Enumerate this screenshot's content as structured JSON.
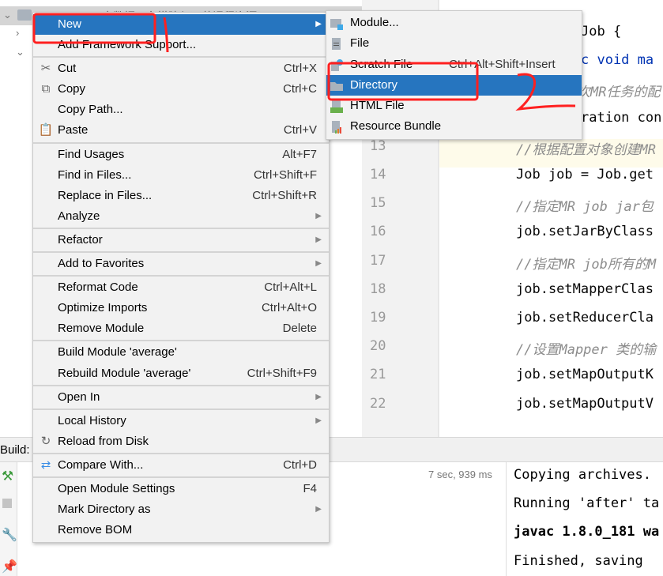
{
  "tree": {
    "root_label": "E:\\大数据平台搭建与运营课程资源"
  },
  "editor": {
    "lines": [
      {
        "num": "",
        "text": "Job {",
        "kind": "code"
      },
      {
        "num": "",
        "text": "c void ma",
        "kind": "kw"
      },
      {
        "num": "",
        "text": "次MR任务的配",
        "kind": "cmt"
      },
      {
        "num": "",
        "text": "ration con",
        "kind": "code"
      },
      {
        "num": "13",
        "text": "//根据配置对象创建MR",
        "kind": "cmt"
      },
      {
        "num": "14",
        "text": "Job job = Job.get",
        "kind": "code"
      },
      {
        "num": "15",
        "text": "//指定MR job jar包",
        "kind": "cmt"
      },
      {
        "num": "16",
        "text": "job.setJarByClass",
        "kind": "code"
      },
      {
        "num": "17",
        "text": "//指定MR job所有的M",
        "kind": "cmt"
      },
      {
        "num": "18",
        "text": "job.setMapperClas",
        "kind": "code"
      },
      {
        "num": "19",
        "text": "job.setReducerCla",
        "kind": "code"
      },
      {
        "num": "20",
        "text": "//设置Mapper 类的输",
        "kind": "cmt"
      },
      {
        "num": "21",
        "text": "job.setMapOutputK",
        "kind": "code"
      },
      {
        "num": "22",
        "text": "job.setMapOutputV",
        "kind": "code"
      }
    ]
  },
  "build": {
    "label": "Build:",
    "time": "7 sec, 939 ms",
    "console": [
      "Copying archives.",
      "Running 'after' ta",
      "javac 1.8.0_181 wa",
      "Finished, saving "
    ]
  },
  "context_menu": {
    "items": [
      {
        "type": "item",
        "label": "New",
        "shortcut": "",
        "submenu": true,
        "highlighted": true,
        "icon": ""
      },
      {
        "type": "item",
        "label": "Add Framework Support...",
        "shortcut": "",
        "submenu": false,
        "icon": ""
      },
      {
        "type": "sep"
      },
      {
        "type": "item",
        "label": "Cut",
        "shortcut": "Ctrl+X",
        "icon": "scissors-icon"
      },
      {
        "type": "item",
        "label": "Copy",
        "shortcut": "Ctrl+C",
        "icon": "copy-icon"
      },
      {
        "type": "item",
        "label": "Copy Path...",
        "shortcut": "",
        "icon": ""
      },
      {
        "type": "item",
        "label": "Paste",
        "shortcut": "Ctrl+V",
        "icon": "clipboard-icon"
      },
      {
        "type": "sep"
      },
      {
        "type": "item",
        "label": "Find Usages",
        "shortcut": "Alt+F7",
        "icon": ""
      },
      {
        "type": "item",
        "label": "Find in Files...",
        "shortcut": "Ctrl+Shift+F",
        "icon": ""
      },
      {
        "type": "item",
        "label": "Replace in Files...",
        "shortcut": "Ctrl+Shift+R",
        "icon": ""
      },
      {
        "type": "item",
        "label": "Analyze",
        "shortcut": "",
        "submenu": true,
        "icon": ""
      },
      {
        "type": "sep"
      },
      {
        "type": "item",
        "label": "Refactor",
        "shortcut": "",
        "submenu": true,
        "icon": ""
      },
      {
        "type": "sep"
      },
      {
        "type": "item",
        "label": "Add to Favorites",
        "shortcut": "",
        "submenu": true,
        "icon": ""
      },
      {
        "type": "sep"
      },
      {
        "type": "item",
        "label": "Reformat Code",
        "shortcut": "Ctrl+Alt+L",
        "icon": ""
      },
      {
        "type": "item",
        "label": "Optimize Imports",
        "shortcut": "Ctrl+Alt+O",
        "icon": ""
      },
      {
        "type": "item",
        "label": "Remove Module",
        "shortcut": "Delete",
        "icon": ""
      },
      {
        "type": "sep"
      },
      {
        "type": "item",
        "label": "Build Module 'average'",
        "shortcut": "",
        "icon": ""
      },
      {
        "type": "item",
        "label": "Rebuild Module 'average'",
        "shortcut": "Ctrl+Shift+F9",
        "icon": ""
      },
      {
        "type": "sep"
      },
      {
        "type": "item",
        "label": "Open In",
        "shortcut": "",
        "submenu": true,
        "icon": ""
      },
      {
        "type": "sep"
      },
      {
        "type": "item",
        "label": "Local History",
        "shortcut": "",
        "submenu": true,
        "icon": ""
      },
      {
        "type": "item",
        "label": "Reload from Disk",
        "shortcut": "",
        "icon": "reload-icon"
      },
      {
        "type": "sep"
      },
      {
        "type": "item",
        "label": "Compare With...",
        "shortcut": "Ctrl+D",
        "icon": "compare-icon"
      },
      {
        "type": "sep"
      },
      {
        "type": "item",
        "label": "Open Module Settings",
        "shortcut": "F4",
        "icon": ""
      },
      {
        "type": "item",
        "label": "Mark Directory as",
        "shortcut": "",
        "submenu": true,
        "icon": ""
      },
      {
        "type": "item",
        "label": "Remove BOM",
        "shortcut": "",
        "icon": ""
      }
    ]
  },
  "new_submenu": {
    "items": [
      {
        "label": "Module...",
        "shortcut": "",
        "icon": "module-icon"
      },
      {
        "label": "File",
        "shortcut": "",
        "icon": "file-icon"
      },
      {
        "label": "Scratch File",
        "shortcut": "Ctrl+Alt+Shift+Insert",
        "icon": "scratch-file-icon"
      },
      {
        "label": "Directory",
        "shortcut": "",
        "icon": "folder-icon",
        "highlighted": true
      },
      {
        "label": "HTML File",
        "shortcut": "",
        "icon": "html-file-icon"
      },
      {
        "label": "Resource Bundle",
        "shortcut": "",
        "icon": "resource-bundle-icon"
      }
    ]
  },
  "annotations": {
    "step2_label": "2",
    "color": "#ff2020"
  },
  "colors": {
    "highlight": "#2675bf",
    "menu_bg": "#f2f2f2"
  }
}
